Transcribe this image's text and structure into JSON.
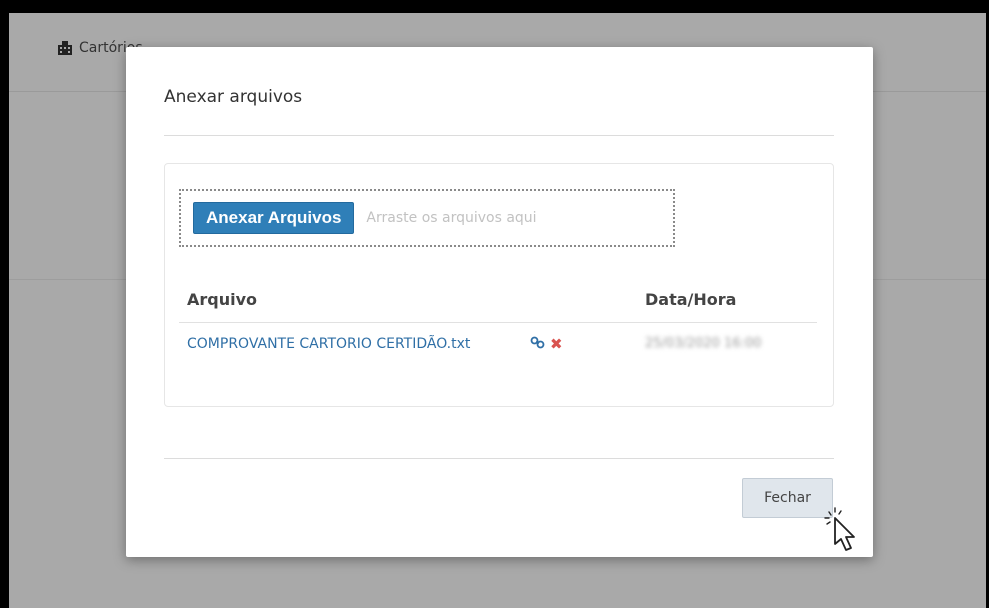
{
  "background": {
    "nav_label": "Cartórios"
  },
  "modal": {
    "title": "Anexar arquivos",
    "attach_button": "Anexar Arquivos",
    "drop_hint": "Arraste os arquivos aqui",
    "table": {
      "columns": [
        "Arquivo",
        "Data/Hora"
      ],
      "rows": [
        {
          "file": "COMPROVANTE CARTORIO CERTIDÃO.txt",
          "datetime": "25/03/2020 16:00"
        }
      ]
    },
    "close_button": "Fechar"
  },
  "colors": {
    "primary_button": "#2f7fb8",
    "link": "#2f6fa6",
    "delete": "#d9534f"
  },
  "icons": {
    "nav": "building-icon",
    "row_link": "link-icon",
    "row_delete": "delete-icon",
    "pointer": "hand-cursor-icon"
  }
}
